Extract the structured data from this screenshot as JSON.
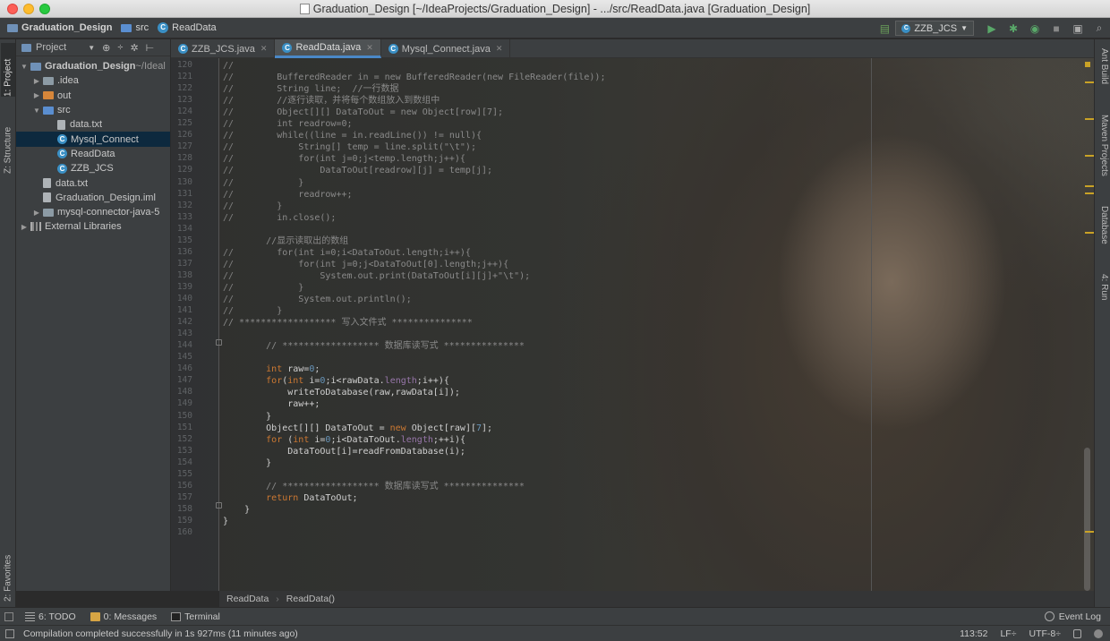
{
  "window": {
    "title": "Graduation_Design [~/IdeaProjects/Graduation_Design] - .../src/ReadData.java [Graduation_Design]"
  },
  "navbar": {
    "crumbs": [
      "Graduation_Design",
      "src",
      "ReadData"
    ],
    "run_config": "ZZB_JCS"
  },
  "left_strip": {
    "project_tab": "1: Project",
    "structure_tab": "Z: Structure",
    "favorites_tab": "2: Favorites"
  },
  "right_strip": {
    "tabs": [
      "Ant Build",
      "Maven Projects",
      "Database",
      "4: Run"
    ]
  },
  "project_panel": {
    "header_label": "Project",
    "tree": [
      {
        "label": "Graduation_Design",
        "suffix": " ~/Ideal",
        "level": 0,
        "type": "module",
        "expanded": true
      },
      {
        "label": ".idea",
        "level": 1,
        "type": "folder",
        "expanded": false
      },
      {
        "label": "out",
        "level": 1,
        "type": "folder-orange",
        "expanded": false
      },
      {
        "label": "src",
        "level": 1,
        "type": "folder-src",
        "expanded": true
      },
      {
        "label": "data.txt",
        "level": 2,
        "type": "file"
      },
      {
        "label": "Mysql_Connect",
        "level": 2,
        "type": "class",
        "selected": true
      },
      {
        "label": "ReadData",
        "level": 2,
        "type": "class"
      },
      {
        "label": "ZZB_JCS",
        "level": 2,
        "type": "class"
      },
      {
        "label": "data.txt",
        "level": 1,
        "type": "file"
      },
      {
        "label": "Graduation_Design.iml",
        "level": 1,
        "type": "file"
      },
      {
        "label": "mysql-connector-java-5",
        "level": 1,
        "type": "folder",
        "expanded": false
      },
      {
        "label": "External Libraries",
        "level": 0,
        "type": "library",
        "expanded": false
      }
    ]
  },
  "editor_tabs": [
    {
      "label": "ZZB_JCS.java",
      "active": false
    },
    {
      "label": "ReadData.java",
      "active": true
    },
    {
      "label": "Mysql_Connect.java",
      "active": false
    }
  ],
  "code_lines": [
    {
      "n": "120",
      "c": [
        [
          "cm-slash",
          "//"
        ]
      ]
    },
    {
      "n": "121",
      "c": [
        [
          "cm-slash",
          "//"
        ],
        [
          "cm",
          "        BufferedReader in = new BufferedReader(new FileReader(file));"
        ]
      ]
    },
    {
      "n": "122",
      "c": [
        [
          "cm-slash",
          "//"
        ],
        [
          "cm",
          "        String line;  //一行数据"
        ]
      ]
    },
    {
      "n": "123",
      "c": [
        [
          "cm-slash",
          "//"
        ],
        [
          "cm",
          "        //逐行读取，并将每个数组放入到数组中"
        ]
      ]
    },
    {
      "n": "124",
      "c": [
        [
          "cm-slash",
          "//"
        ],
        [
          "cm",
          "        Object[][] DataToOut = new Object[row][7];"
        ]
      ]
    },
    {
      "n": "125",
      "c": [
        [
          "cm-slash",
          "//"
        ],
        [
          "cm",
          "        int readrow=0;"
        ]
      ]
    },
    {
      "n": "126",
      "c": [
        [
          "cm-slash",
          "//"
        ],
        [
          "cm",
          "        while((line = in.readLine()) != null){"
        ]
      ]
    },
    {
      "n": "127",
      "c": [
        [
          "cm-slash",
          "//"
        ],
        [
          "cm",
          "            String[] temp = line.split(\"\\t\");"
        ]
      ]
    },
    {
      "n": "128",
      "c": [
        [
          "cm-slash",
          "//"
        ],
        [
          "cm",
          "            for(int j=0;j<temp.length;j++){"
        ]
      ]
    },
    {
      "n": "129",
      "c": [
        [
          "cm-slash",
          "//"
        ],
        [
          "cm",
          "                DataToOut[readrow][j] = temp[j];"
        ]
      ]
    },
    {
      "n": "130",
      "c": [
        [
          "cm-slash",
          "//"
        ],
        [
          "cm",
          "            }"
        ]
      ]
    },
    {
      "n": "131",
      "c": [
        [
          "cm-slash",
          "//"
        ],
        [
          "cm",
          "            readrow++;"
        ]
      ]
    },
    {
      "n": "132",
      "c": [
        [
          "cm-slash",
          "//"
        ],
        [
          "cm",
          "        }"
        ]
      ]
    },
    {
      "n": "133",
      "c": [
        [
          "cm-slash",
          "//"
        ],
        [
          "cm",
          "        in.close();"
        ]
      ]
    },
    {
      "n": "134",
      "c": []
    },
    {
      "n": "135",
      "c": [
        [
          "cm",
          "        //显示读取出的数组"
        ]
      ]
    },
    {
      "n": "136",
      "c": [
        [
          "cm-slash",
          "//"
        ],
        [
          "cm",
          "        for(int i=0;i<DataToOut.length;i++){"
        ]
      ]
    },
    {
      "n": "137",
      "c": [
        [
          "cm-slash",
          "//"
        ],
        [
          "cm",
          "            for(int j=0;j<DataToOut[0].length;j++){"
        ]
      ]
    },
    {
      "n": "138",
      "c": [
        [
          "cm-slash",
          "//"
        ],
        [
          "cm",
          "                System.out.print(DataToOut[i][j]+\"\\t\");"
        ]
      ]
    },
    {
      "n": "139",
      "c": [
        [
          "cm-slash",
          "//"
        ],
        [
          "cm",
          "            }"
        ]
      ]
    },
    {
      "n": "140",
      "c": [
        [
          "cm-slash",
          "//"
        ],
        [
          "cm",
          "            System.out.println();"
        ]
      ]
    },
    {
      "n": "141",
      "c": [
        [
          "cm-slash",
          "//"
        ],
        [
          "cm",
          "        }"
        ]
      ]
    },
    {
      "n": "142",
      "c": [
        [
          "cm",
          "// ****************** 写入文件式 ***************"
        ]
      ]
    },
    {
      "n": "143",
      "c": []
    },
    {
      "n": "144",
      "c": [
        [
          "cm",
          "        // ****************** 数据库读写式 ***************"
        ]
      ]
    },
    {
      "n": "145",
      "c": []
    },
    {
      "n": "146",
      "c": [
        [
          "kw",
          "        int "
        ],
        [
          "plain",
          "raw="
        ],
        [
          "num",
          "0"
        ],
        [
          "plain",
          ";"
        ]
      ]
    },
    {
      "n": "147",
      "c": [
        [
          "kw",
          "        for"
        ],
        [
          "plain",
          "("
        ],
        [
          "kw",
          "int "
        ],
        [
          "plain",
          "i="
        ],
        [
          "num",
          "0"
        ],
        [
          "plain",
          ";i<rawData."
        ],
        [
          "field",
          "length"
        ],
        [
          "plain",
          ";i++){"
        ]
      ]
    },
    {
      "n": "148",
      "c": [
        [
          "plain",
          "            writeToDatabase(raw,rawData[i]);"
        ]
      ]
    },
    {
      "n": "149",
      "c": [
        [
          "plain",
          "            raw++;"
        ]
      ]
    },
    {
      "n": "150",
      "c": [
        [
          "plain",
          "        }"
        ]
      ]
    },
    {
      "n": "151",
      "c": [
        [
          "plain",
          "        Object[][] DataToOut = "
        ],
        [
          "kw",
          "new "
        ],
        [
          "plain",
          "Object[raw]["
        ],
        [
          "num",
          "7"
        ],
        [
          "plain",
          "];"
        ]
      ]
    },
    {
      "n": "152",
      "c": [
        [
          "kw",
          "        for "
        ],
        [
          "plain",
          "("
        ],
        [
          "kw",
          "int "
        ],
        [
          "plain",
          "i="
        ],
        [
          "num",
          "0"
        ],
        [
          "plain",
          ";i<DataToOut."
        ],
        [
          "field",
          "length"
        ],
        [
          "plain",
          ";++i){"
        ]
      ]
    },
    {
      "n": "153",
      "c": [
        [
          "plain",
          "            DataToOut[i]=readFromDatabase(i);"
        ]
      ]
    },
    {
      "n": "154",
      "c": [
        [
          "plain",
          "        }"
        ]
      ]
    },
    {
      "n": "155",
      "c": []
    },
    {
      "n": "156",
      "c": [
        [
          "cm",
          "        // ****************** 数据库读写式 ***************"
        ]
      ]
    },
    {
      "n": "157",
      "c": [
        [
          "kw",
          "        return "
        ],
        [
          "plain",
          "DataToOut;"
        ]
      ]
    },
    {
      "n": "158",
      "c": [
        [
          "plain",
          "    }"
        ]
      ]
    },
    {
      "n": "159",
      "c": [
        [
          "plain",
          "}"
        ]
      ]
    },
    {
      "n": "160",
      "c": []
    }
  ],
  "breadcrumb": {
    "items": [
      "ReadData",
      "ReadData()"
    ]
  },
  "tool_windows": {
    "todo": "6: TODO",
    "messages": "0: Messages",
    "terminal": "Terminal",
    "event_log": "Event Log"
  },
  "status": {
    "message": "Compilation completed successfully in 1s 927ms (11 minutes ago)",
    "position": "113:52",
    "line_sep": "LF÷",
    "encoding": "UTF-8÷"
  },
  "colors": {
    "keyword": "#cc7832",
    "number": "#6897bb",
    "comment": "#8a8a8a",
    "selection": "#0d293e",
    "accent": "#4a88c7"
  }
}
